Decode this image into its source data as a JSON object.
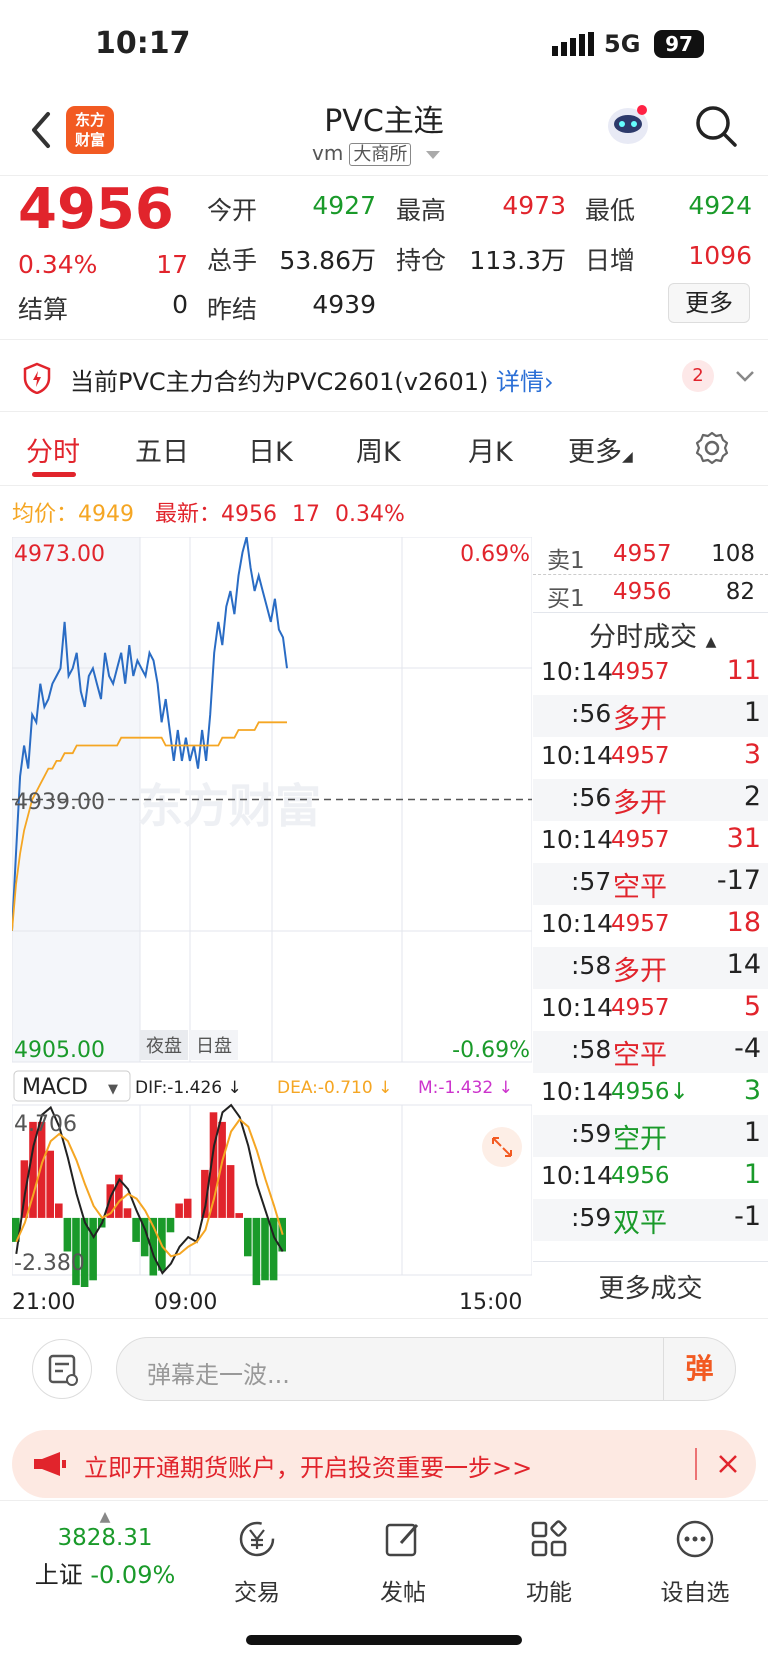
{
  "status_bar": {
    "time": "10:17",
    "network": "5G",
    "battery": "97"
  },
  "header": {
    "logo_text_line1": "东方",
    "logo_text_line2": "财富",
    "title": "PVC主连",
    "code": "vm",
    "exchange": "大商所"
  },
  "quote": {
    "price": "4956",
    "change_pct": "0.34%",
    "change": "17",
    "open_label": "今开",
    "open": "4927",
    "high_label": "最高",
    "high": "4973",
    "low_label": "最低",
    "low": "4924",
    "volume_label": "总手",
    "volume": "53.86万",
    "oi_label": "持仓",
    "oi": "113.3万",
    "daily_inc_label": "日增",
    "daily_inc": "1096",
    "settle_label": "结算",
    "settle": "0",
    "prev_settle_label": "昨结",
    "prev_settle": "4939",
    "more_label": "更多"
  },
  "notice": {
    "text": "当前PVC主力合约为PVC2601(v2601)",
    "link": "详情",
    "badge": "2"
  },
  "tabs": [
    "分时",
    "五日",
    "日K",
    "周K",
    "月K",
    "更多"
  ],
  "info_row": {
    "avg_label": "均价：",
    "avg": "4949",
    "latest_label": "最新：",
    "latest": "4956",
    "latest_change": "17",
    "latest_pct": "0.34%"
  },
  "chart_data": {
    "type": "line",
    "y_max_label": "4973.00",
    "y_mid_label": "4939.00",
    "y_min_label": "4905.00",
    "pct_max_label": "0.69%",
    "pct_min_label": "-0.69%",
    "ylim": [
      4905,
      4973
    ],
    "prev_settle": 4939,
    "session_labels": [
      "夜盘",
      "日盘"
    ],
    "x_tick_labels": [
      "21:00",
      "09:00",
      "15:00"
    ],
    "watermark": "东方财富",
    "series": [
      {
        "values": [
          4922,
          4932,
          4942,
          4946,
          4943,
          4950,
          4949,
          4954,
          4951,
          4952,
          4954,
          4955,
          4956,
          4962,
          4955,
          4956,
          4958,
          4953,
          4951,
          4955,
          4956,
          4954,
          4952,
          4958,
          4955,
          4954,
          4956,
          4958,
          4954,
          4959,
          4955,
          4957,
          4956,
          4955,
          4958,
          4957,
          4954,
          4949,
          4952,
          4948,
          4944,
          4948,
          4944,
          4947,
          4944,
          4946,
          4943,
          4948,
          4944,
          4950,
          4958,
          4962,
          4959,
          4964,
          4966,
          4963,
          4968,
          4971,
          4973,
          4969,
          4966,
          4968,
          4966,
          4964,
          4962,
          4965,
          4961,
          4960,
          4956
        ]
      },
      {
        "values": [
          4922,
          4928,
          4932,
          4935,
          4937,
          4939,
          4940,
          4941,
          4942,
          4943,
          4943,
          4944,
          4944,
          4945,
          4945,
          4945,
          4946,
          4946,
          4946,
          4946,
          4946,
          4946,
          4946,
          4946,
          4946,
          4946,
          4946,
          4947,
          4947,
          4947,
          4947,
          4947,
          4947,
          4947,
          4947,
          4947,
          4947,
          4947,
          4946,
          4946,
          4946,
          4946,
          4946,
          4946,
          4946,
          4946,
          4946,
          4946,
          4946,
          4946,
          4946,
          4946,
          4947,
          4947,
          4947,
          4947,
          4948,
          4948,
          4948,
          4948,
          4948,
          4949,
          4949,
          4949,
          4949,
          4949,
          4949,
          4949,
          4949
        ]
      }
    ]
  },
  "macd": {
    "name": "MACD",
    "dif": "DIF:-1.426 ↓",
    "dea": "DEA:-0.710 ↓",
    "m": "M:-1.432 ↓",
    "max_label": "4.706",
    "min_label": "-2.380",
    "ylim": [
      -2.38,
      4.706
    ],
    "dif_values": [
      -1.5,
      1.0,
      3.0,
      4.3,
      4.6,
      3.8,
      2.5,
      1.0,
      -0.2,
      -0.8,
      -0.2,
      0.9,
      1.6,
      1.2,
      0.3,
      -0.5,
      -1.6,
      -2.3,
      -1.9,
      -1.2,
      -0.8,
      -1.0,
      0.5,
      3.0,
      4.4,
      4.7,
      4.2,
      3.0,
      1.4,
      0.3,
      -0.8,
      -1.4
    ],
    "dea_values": [
      -1.0,
      -0.2,
      1.0,
      2.3,
      3.2,
      3.5,
      3.2,
      2.4,
      1.4,
      0.5,
      0.0,
      0.2,
      0.7,
      1.0,
      0.8,
      0.3,
      -0.4,
      -1.2,
      -1.6,
      -1.5,
      -1.2,
      -1.0,
      -0.5,
      0.8,
      2.4,
      3.6,
      4.1,
      3.8,
      2.8,
      1.6,
      0.5,
      -0.7
    ],
    "hist_values": [
      -1.0,
      2.4,
      4.0,
      4.0,
      2.8,
      0.6,
      -1.4,
      -2.8,
      -3.2,
      -2.6,
      -0.4,
      1.4,
      1.8,
      0.4,
      -1.0,
      -1.6,
      -2.4,
      -2.2,
      -0.6,
      0.6,
      0.8,
      0.0,
      2.0,
      4.4,
      4.0,
      2.2,
      0.2,
      -1.6,
      -2.8,
      -2.6,
      -2.6,
      -1.4
    ]
  },
  "order_book": {
    "sell_label": "卖1",
    "sell_price": "4957",
    "sell_vol": "108",
    "buy_label": "买1",
    "buy_price": "4956",
    "buy_vol": "82"
  },
  "trades": {
    "title": "分时成交",
    "rows": [
      {
        "time": "10:14",
        "price": "4957",
        "vol": "11",
        "kind": "red"
      },
      {
        "time": ":56",
        "label": "多开",
        "vol": "1",
        "kind": "red"
      },
      {
        "time": "10:14",
        "price": "4957",
        "vol": "3",
        "kind": "red"
      },
      {
        "time": ":56",
        "label": "多开",
        "vol": "2",
        "kind": "red"
      },
      {
        "time": "10:14",
        "price": "4957",
        "vol": "31",
        "kind": "red"
      },
      {
        "time": ":57",
        "label": "空平",
        "vol": "-17",
        "kind": "red"
      },
      {
        "time": "10:14",
        "price": "4957",
        "vol": "18",
        "kind": "red"
      },
      {
        "time": ":58",
        "label": "多开",
        "vol": "14",
        "kind": "red"
      },
      {
        "time": "10:14",
        "price": "4957",
        "vol": "5",
        "kind": "red"
      },
      {
        "time": ":58",
        "label": "空平",
        "vol": "-4",
        "kind": "red"
      },
      {
        "time": "10:14",
        "price": "4956↓",
        "vol": "3",
        "kind": "green"
      },
      {
        "time": ":59",
        "label": "空开",
        "vol": "1",
        "kind": "green"
      },
      {
        "time": "10:14",
        "price": "4956",
        "vol": "1",
        "kind": "green"
      },
      {
        "time": ":59",
        "label": "双平",
        "vol": "-1",
        "kind": "green"
      }
    ],
    "more": "更多成交"
  },
  "comment": {
    "placeholder": "弹幕走一波...",
    "danmu": "弹"
  },
  "promo": {
    "text": "立即开通期货账户，开启投资重要一步>>"
  },
  "bottom_nav": {
    "index_value": "3828.31",
    "index_name": "上证",
    "index_pct": "-0.09%",
    "items": [
      "交易",
      "发帖",
      "功能",
      "设自选"
    ]
  }
}
